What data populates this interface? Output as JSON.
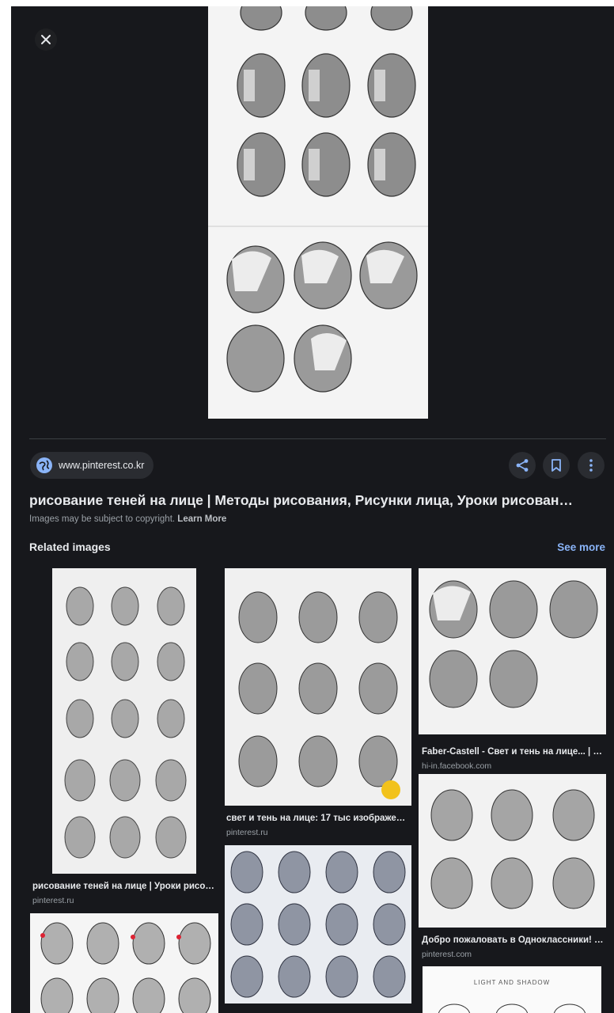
{
  "viewer": {
    "close_icon": "close-icon",
    "source_domain": "www.pinterest.co.kr",
    "title": "рисование теней на лице | Методы рисования, Рисунки лица, Уроки рисован…",
    "copyright_text": "Images may be subject to copyright.",
    "learn_more": "Learn More"
  },
  "actions": {
    "share_icon": "share-icon",
    "save_icon": "bookmark-icon",
    "more_icon": "more-vertical-icon"
  },
  "related": {
    "heading": "Related images",
    "see_more": "See more",
    "items": [
      {
        "title": "рисование теней на лице | Уроки рисо…",
        "source": "pinterest.ru"
      },
      {
        "title": "свет и тень на лице: 17 тыс изображе…",
        "source": "pinterest.ru"
      },
      {
        "title": "Faber-Castell - Свет и тень на лице... | …",
        "source": "hi-in.facebook.com"
      },
      {
        "title": "Добро пожаловать в Одноклассники! …",
        "source": "pinterest.com"
      }
    ],
    "extra_thumb_caption": "LIGHT AND SHADOW"
  },
  "colors": {
    "panel_bg": "#17181c",
    "accent": "#8ab4f8",
    "chip_bg": "#2a2c31"
  }
}
